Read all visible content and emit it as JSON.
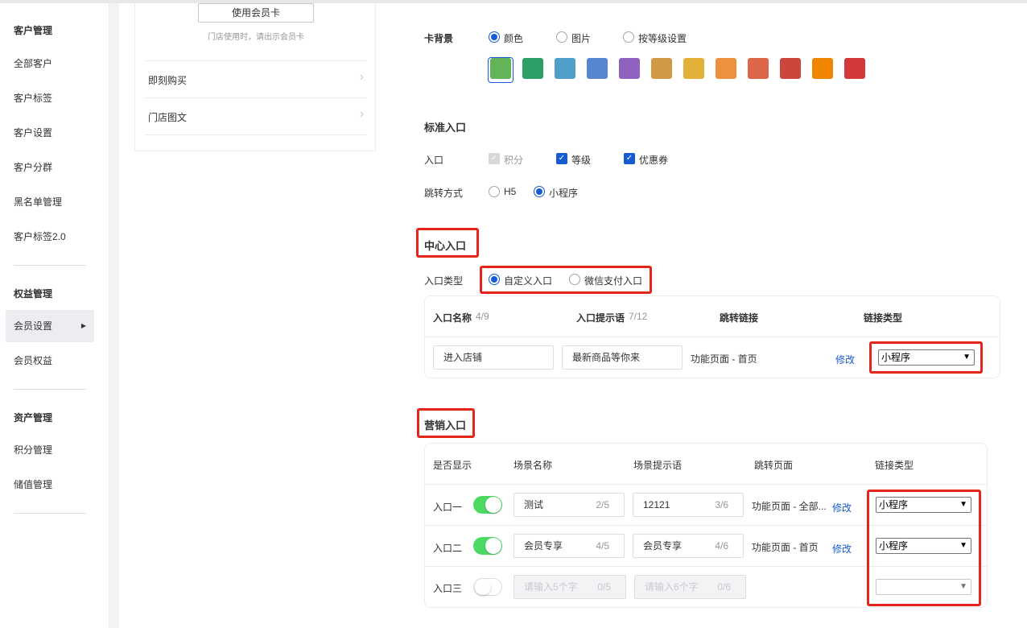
{
  "sidebar": {
    "group1": "客户管理",
    "items1": [
      "全部客户",
      "客户标签",
      "客户设置",
      "客户分群",
      "黑名单管理",
      "客户标签2.0"
    ],
    "group2": "权益管理",
    "items2": [
      "会员设置",
      "会员权益"
    ],
    "active_item": "会员设置",
    "group3": "资产管理",
    "items3": [
      "积分管理",
      "储值管理"
    ]
  },
  "preview": {
    "use_card_button": "使用会员卡",
    "store_tip": "门店使用时，请出示会员卡",
    "rows": [
      "即刻购买",
      "门店图文"
    ]
  },
  "card_bg": {
    "label": "卡背景",
    "options": [
      "颜色",
      "图片",
      "按等级设置"
    ],
    "selected": "颜色",
    "colors": [
      "#63b359",
      "#2c9f67",
      "#509fc9",
      "#5885cf",
      "#9062c0",
      "#d09a45",
      "#e4b138",
      "#ee903c",
      "#dd6549",
      "#cc463d",
      "#f08500",
      "#d3393b"
    ]
  },
  "standard_entry": {
    "title": "标准入口",
    "entry_label": "入口",
    "entries": [
      {
        "label": "积分",
        "checked": true,
        "disabled": true
      },
      {
        "label": "等级",
        "checked": true,
        "disabled": false
      },
      {
        "label": "优惠券",
        "checked": true,
        "disabled": false
      }
    ],
    "jump_label": "跳转方式",
    "jump_options": [
      "H5",
      "小程序"
    ],
    "jump_selected": "小程序"
  },
  "center_entry": {
    "title": "中心入口",
    "type_label": "入口类型",
    "type_options": [
      "自定义入口",
      "微信支付入口"
    ],
    "type_selected": "自定义入口",
    "headers": {
      "name": "入口名称",
      "name_count": "4/9",
      "hint": "入口提示语",
      "hint_count": "7/12",
      "link": "跳转链接",
      "link_type": "链接类型"
    },
    "row": {
      "name": "进入店铺",
      "hint": "最新商品等你来",
      "page": "功能页面 - 首页",
      "modify": "修改",
      "link_type": "小程序"
    }
  },
  "marketing_entry": {
    "title": "营销入口",
    "headers": [
      "是否显示",
      "场景名称",
      "场景提示语",
      "跳转页面",
      "链接类型"
    ],
    "rows": [
      {
        "label": "入口一",
        "on": true,
        "name": "测试",
        "name_count": "2/5",
        "hint": "12121",
        "hint_count": "3/6",
        "page": "功能页面 - 全部...",
        "modify": "修改",
        "link_type": "小程序"
      },
      {
        "label": "入口二",
        "on": true,
        "name": "会员专享",
        "name_count": "4/5",
        "hint": "会员专享",
        "hint_count": "4/6",
        "page": "功能页面 - 首页",
        "modify": "修改",
        "link_type": "小程序"
      },
      {
        "label": "入口三",
        "on": false,
        "name_placeholder": "请输入5个字",
        "name_count": "0/5",
        "hint_placeholder": "请输入6个字",
        "hint_count": "0/6",
        "link_type": ""
      }
    ]
  },
  "accent_color": "#155bd4",
  "highlight_color": "#e5251a",
  "toggle_on_color": "#4cd964"
}
